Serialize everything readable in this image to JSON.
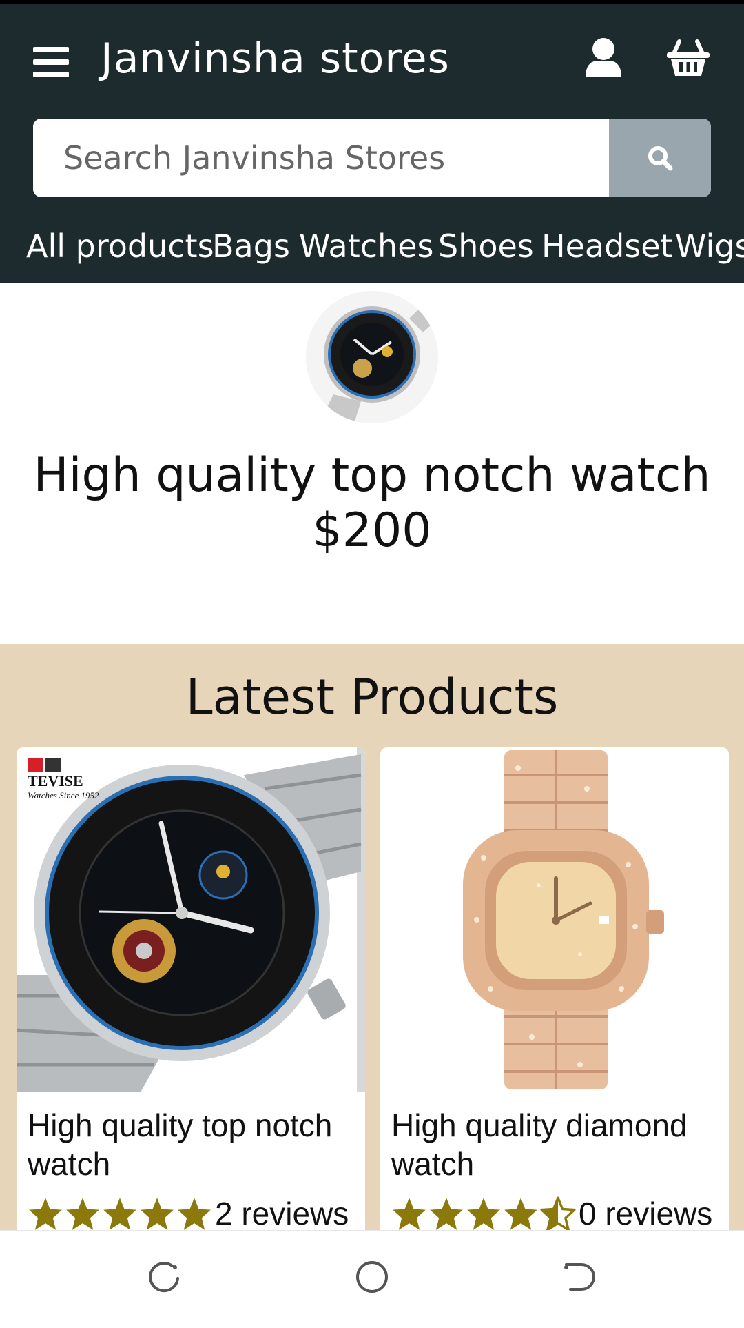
{
  "header": {
    "brand": "Janvinsha stores",
    "search_placeholder": "Search Janvinsha Stores",
    "background_color": "#1d2b2e",
    "search_button_color": "#9aa6ad"
  },
  "nav": {
    "items": [
      "All products",
      "Bags",
      "Watches",
      "Shoes",
      "Headset",
      "Wigs"
    ],
    "active": "All products"
  },
  "featured": {
    "title": "High quality top notch watch",
    "price": "$200",
    "image_icon": "watch-image"
  },
  "latest": {
    "heading": "Latest Products",
    "background_color": "#e6d5b8",
    "products": [
      {
        "title": "High quality top notch watch",
        "rating": 5,
        "reviews": "2 reviews",
        "image_icon": "tevise-watch-image",
        "brand_mark": "TEVISE",
        "brand_tagline": "Watches Since 1952"
      },
      {
        "title": "High quality diamond watch",
        "rating": 4.5,
        "reviews": "0 reviews",
        "image_icon": "diamond-watch-image"
      }
    ]
  },
  "star_color": "#8b7a0b",
  "system_nav": {
    "icons": [
      "recents-icon",
      "home-icon",
      "back-icon"
    ]
  }
}
